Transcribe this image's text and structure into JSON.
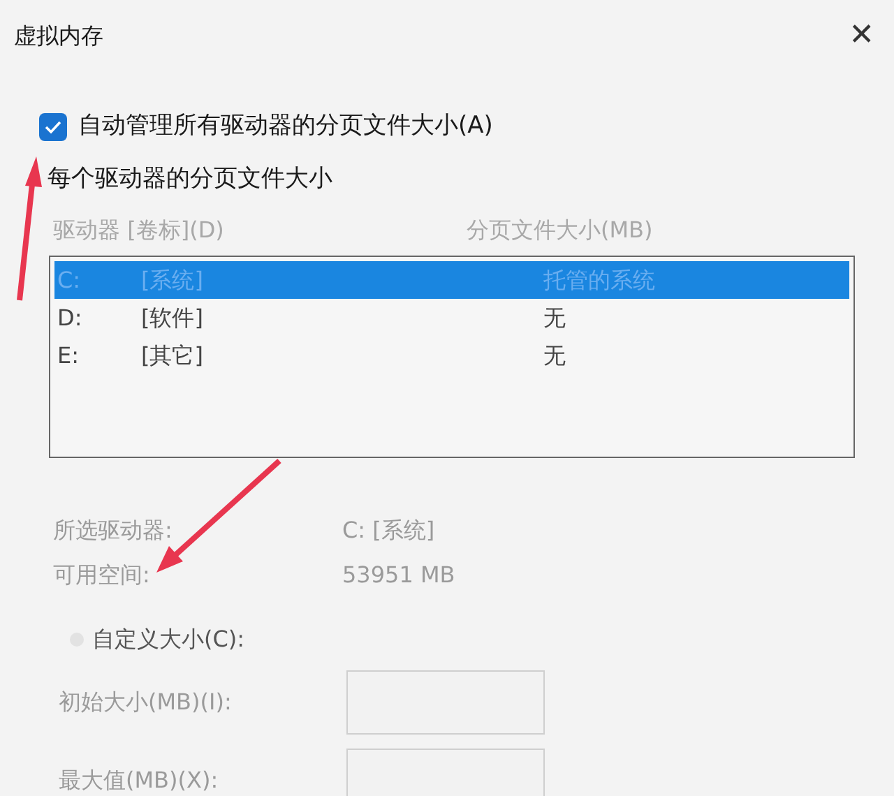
{
  "window": {
    "title": "虚拟内存",
    "close": "✕"
  },
  "auto_manage": {
    "label": "自动管理所有驱动器的分页文件大小(A)",
    "checked": true
  },
  "section_title": "每个驱动器的分页文件大小",
  "table": {
    "columns": [
      "驱动器 [卷标](D)",
      "分页文件大小(MB)"
    ],
    "rows": [
      {
        "drive": "C:",
        "label": "[系统]",
        "size": "托管的系统",
        "selected": true
      },
      {
        "drive": "D:",
        "label": "[软件]",
        "size": "无",
        "selected": false
      },
      {
        "drive": "E:",
        "label": "[其它]",
        "size": "无",
        "selected": false
      }
    ]
  },
  "info": [
    {
      "label": "所选驱动器:",
      "value": "C: [系统]"
    },
    {
      "label": "可用空间:",
      "value": "53951 MB"
    }
  ],
  "custom_size": {
    "label": "自定义大小(C):",
    "selected": false,
    "disabled": true
  },
  "fields": [
    {
      "label": "初始大小(MB)(I):"
    },
    {
      "label": "最大值(MB)(X):"
    }
  ]
}
